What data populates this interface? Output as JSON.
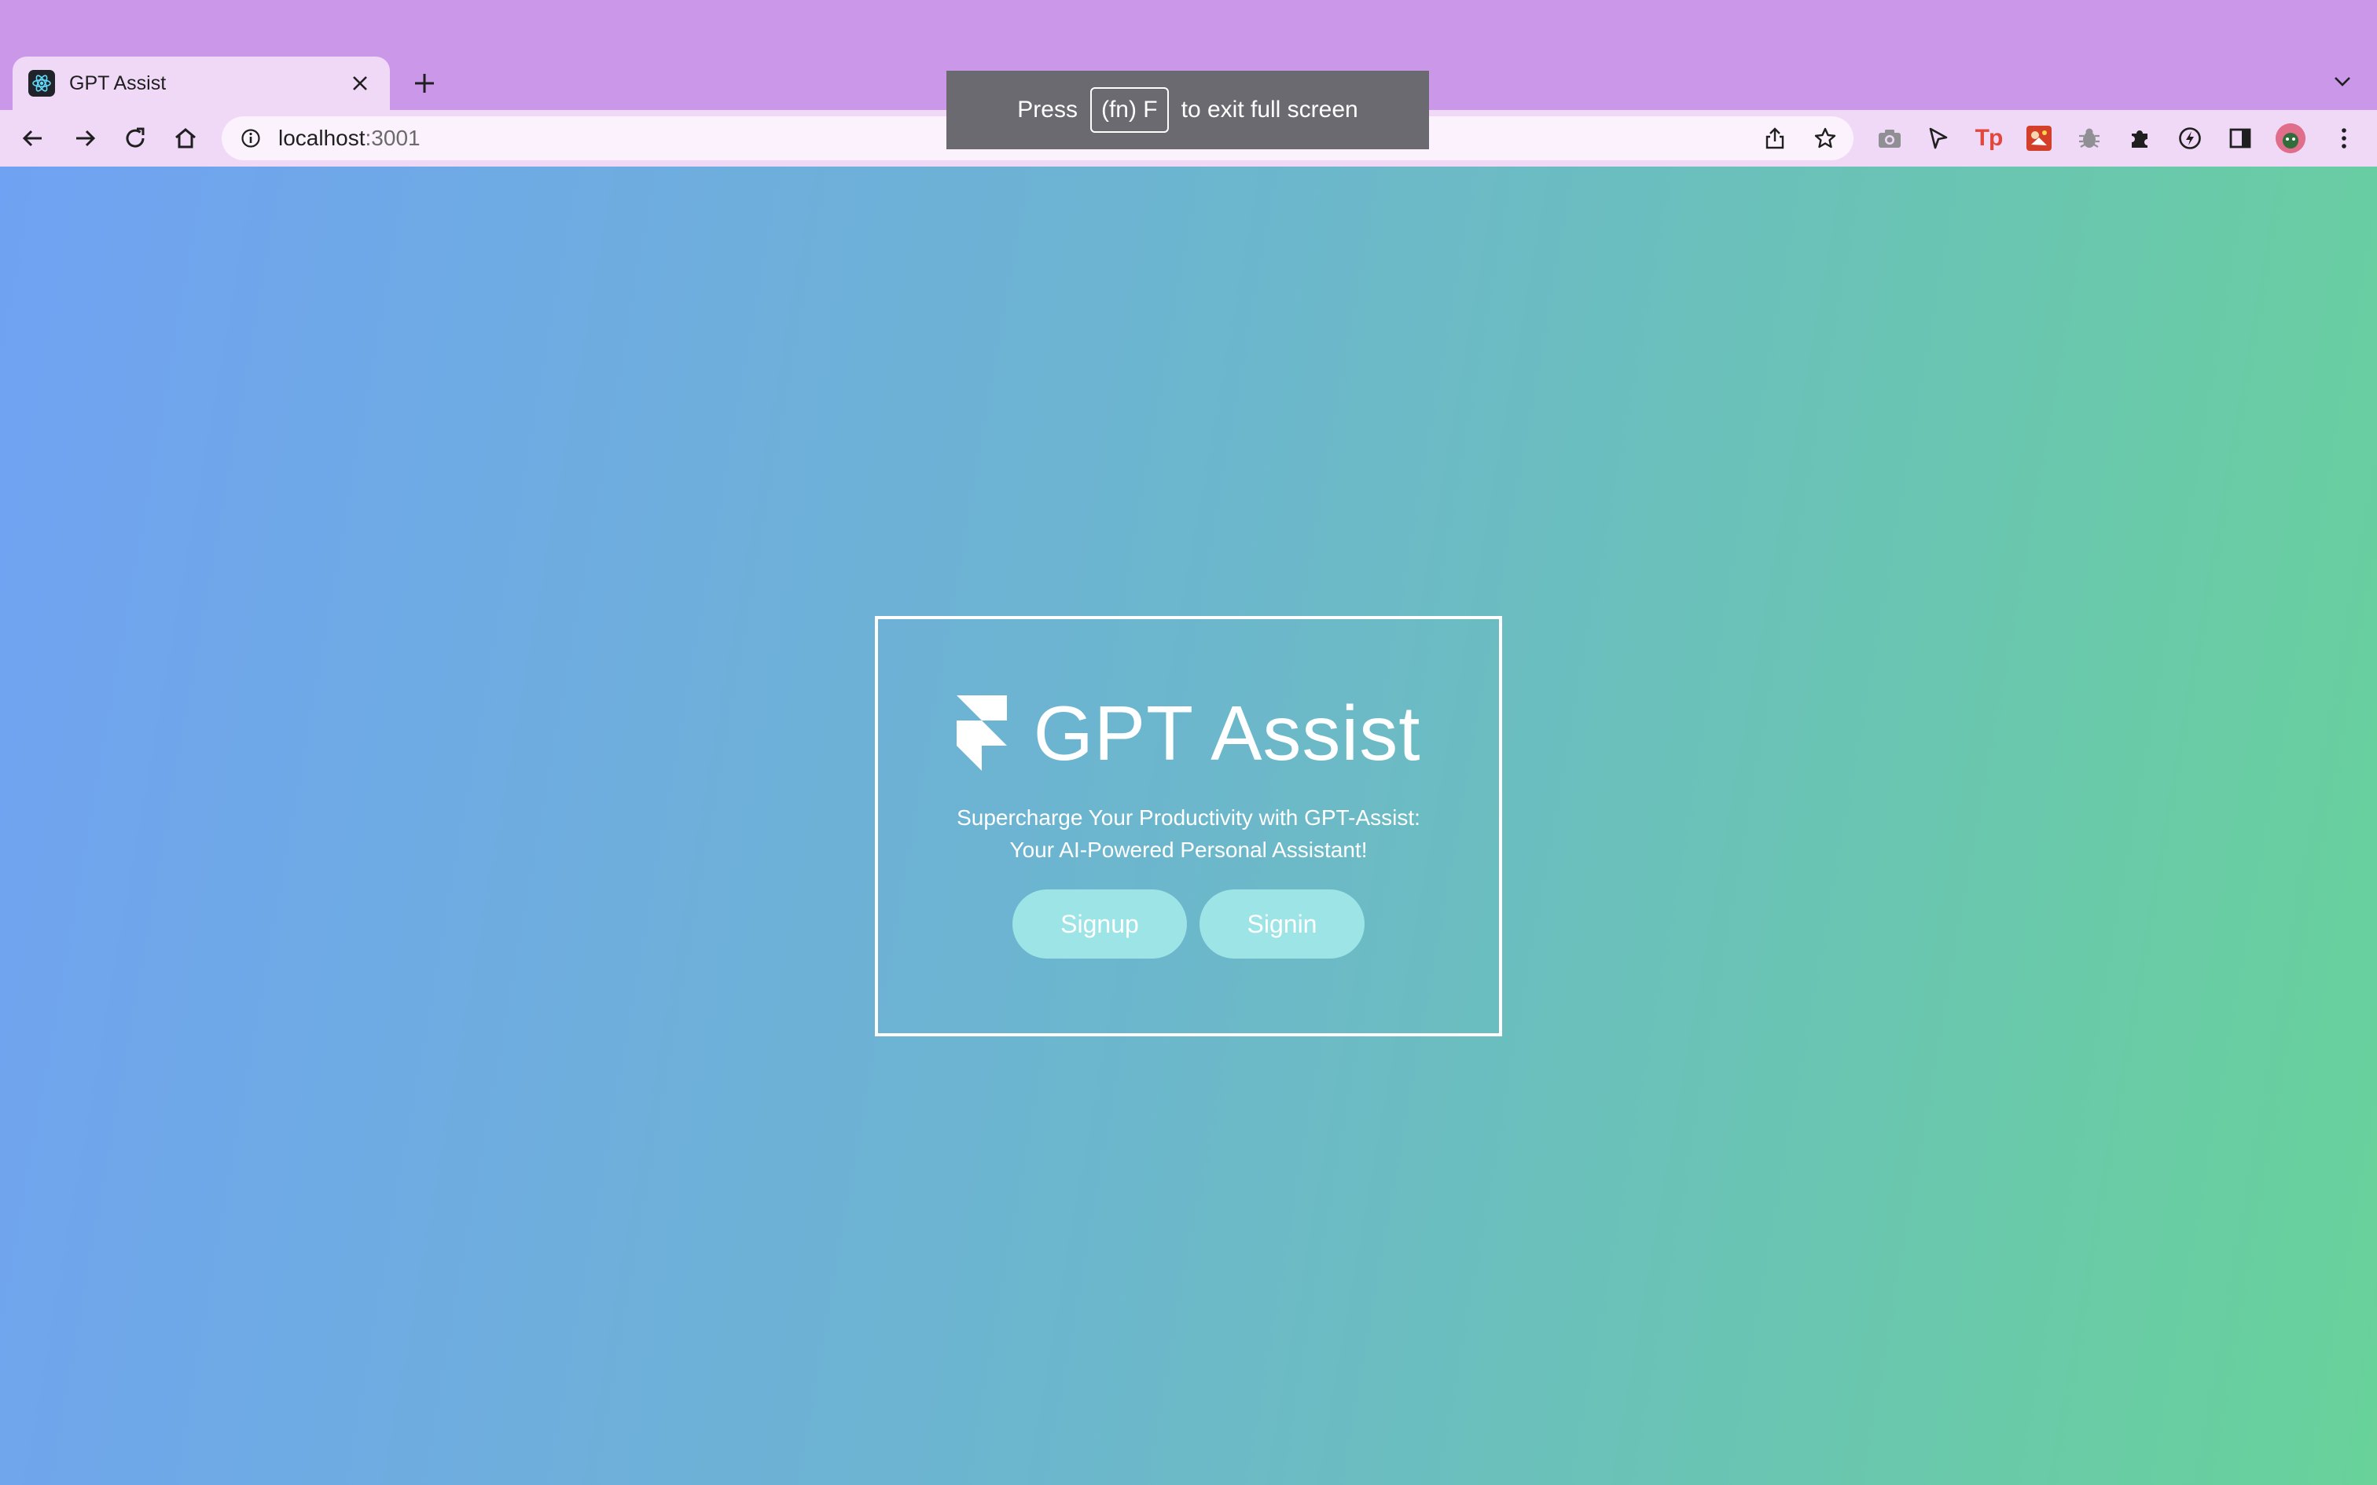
{
  "browser": {
    "tab": {
      "title": "GPT Assist",
      "favicon": "react-logo-icon"
    },
    "new_tab": "+",
    "address_bar": {
      "host": "localhost",
      "port": ":3001"
    },
    "fullscreen_hint": {
      "press": "Press",
      "key": "(fn) F",
      "suffix": "to exit full screen"
    },
    "colors": {
      "frame": "#cb97e9",
      "toolbar": "#f0d9f7"
    }
  },
  "app": {
    "title": "GPT Assist",
    "tagline_line1": "Supercharge Your Productivity with GPT-Assist:",
    "tagline_line2": "Your AI-Powered Personal Assistant!",
    "buttons": {
      "signup": "Signup",
      "signin": "Signin"
    },
    "colors": {
      "gradient_start": "#70a2f3",
      "gradient_mid": "#6cb7cc",
      "gradient_end": "#68d29a",
      "button": "#9de4e6"
    }
  }
}
